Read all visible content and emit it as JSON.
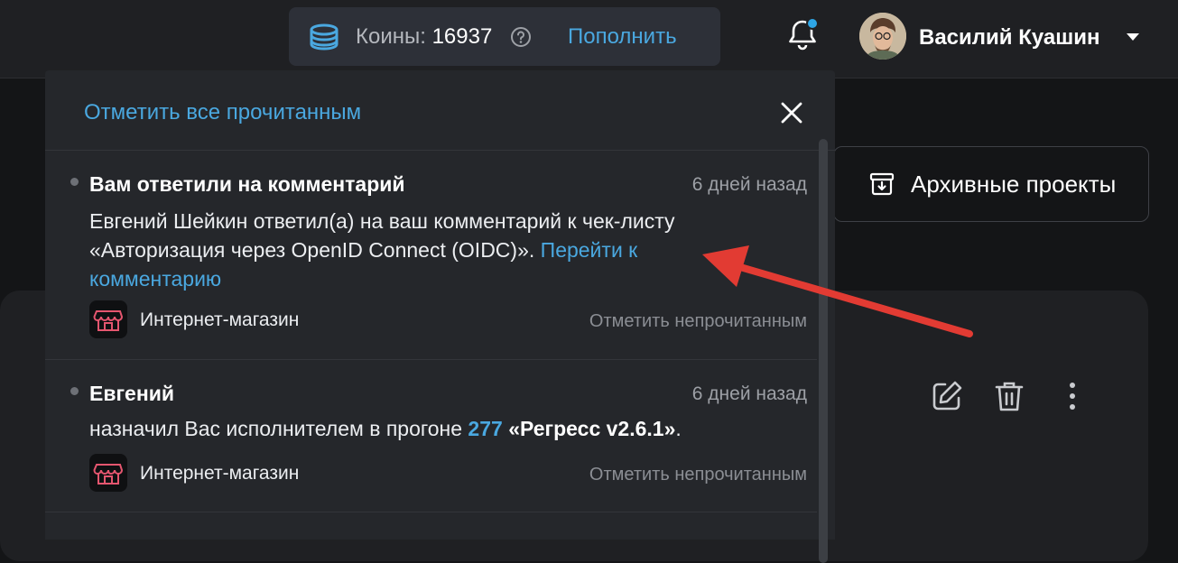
{
  "topbar": {
    "coins_label": "Коины:",
    "coins_value": "16937",
    "topup_label": "Пополнить",
    "user_name": "Василий Куашин"
  },
  "archive": {
    "label": "Архивные проекты"
  },
  "notifications": {
    "mark_all_label": "Отметить все прочитанным",
    "items": [
      {
        "title": "Вам ответили на комментарий",
        "time": "6 дней назад",
        "text": "Евгений Шейкин ответил(а) на ваш комментарий к чек-листу «Авторизация через OpenID Connect (OIDC)».",
        "link": "Перейти к комментарию",
        "project": "Интернет-магазин",
        "mark_unread": "Отметить непрочитанным"
      },
      {
        "title": "Евгений",
        "time": "6 дней назад",
        "text_before": "назначил Вас исполнителем в прогоне",
        "run_number": "277",
        "run_name": "«Регресс v2.6.1»",
        "text_after": ".",
        "project": "Интернет-магазин",
        "mark_unread": "Отметить непрочитанным"
      }
    ]
  },
  "colors": {
    "accent": "#4aa8e0",
    "arrow": "#e23b33",
    "badge": "#2ea6e6",
    "panel": "#25272b"
  }
}
